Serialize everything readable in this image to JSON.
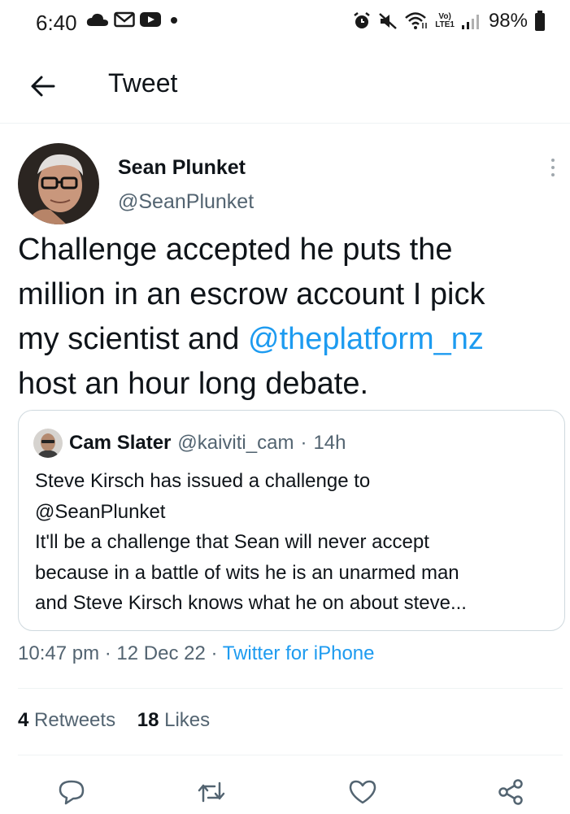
{
  "status_bar": {
    "time": "6:40",
    "battery": "98%",
    "network_label_top": "Vo)",
    "network_label_bottom": "LTE1",
    "left_icons": [
      "cloud-icon",
      "gmail-icon",
      "youtube-icon",
      "dot-icon"
    ],
    "right_icons": [
      "alarm-icon",
      "mute-icon",
      "wifi-icon",
      "signal-icon",
      "battery-icon"
    ]
  },
  "header": {
    "back_icon": "arrow-left-icon",
    "title": "Tweet"
  },
  "tweet": {
    "author_name": "Sean Plunket",
    "author_handle": "@SeanPlunket",
    "text_line1": "Challenge accepted he puts the",
    "text_line2": "million in an escrow account I pick",
    "text_line3_prefix": "my scientist and ",
    "mention": "@theplatform_nz",
    "text_line4": "host an hour long debate.",
    "time": "10:47 pm",
    "date": "12 Dec 22",
    "source": "Twitter for iPhone",
    "separator": "·"
  },
  "quote": {
    "author_name": "Cam Slater",
    "author_handle": "@kaiviti_cam",
    "age": "14h",
    "line1": "Steve Kirsch has issued a challenge to",
    "line2": "@SeanPlunket",
    "line3": "It'll be a challenge that Sean will never accept",
    "line4": "because in a battle of wits he is an unarmed man",
    "line5": "and Steve Kirsch knows what he on about steve..."
  },
  "stats": {
    "retweets_count": "4",
    "retweets_label": "Retweets",
    "likes_count": "18",
    "likes_label": "Likes"
  },
  "actions": [
    "reply-icon",
    "retweet-icon",
    "like-icon",
    "share-icon"
  ],
  "colors": {
    "accent": "#1d9bf0",
    "text": "#0f1419",
    "secondary": "#536471",
    "border": "#cfd9de"
  }
}
